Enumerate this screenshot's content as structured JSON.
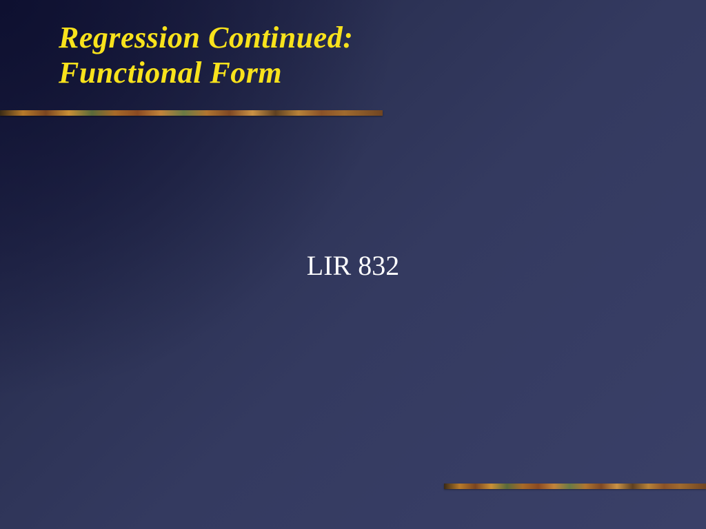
{
  "slide": {
    "title_line1": "Regression Continued:",
    "title_line2": "Functional Form",
    "subtitle": "LIR 832"
  }
}
